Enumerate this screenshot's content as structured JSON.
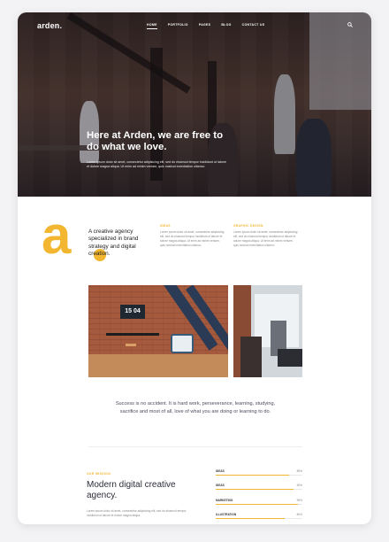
{
  "nav": {
    "logo": "arden.",
    "items": [
      "HOME",
      "PORTFOLIO",
      "PAGES",
      "BLOG",
      "CONTACT US"
    ],
    "active_index": 0
  },
  "hero": {
    "title": "Here at Arden, we are free to do what we love.",
    "text": "Lorem ipsum dolor sit amet, consectetur adipisicing elit, sed do eiusmod tempor incididunt ut labore et dolore magna aliqua. Ut enim ad minim veniam, quis nostrud exercitation ullamco"
  },
  "intro": {
    "letter": "a",
    "title": "A creative agency specialized in brand strategy and digital creation.",
    "col1_title": "IDEAS",
    "col1_text": "Lorem ipsum dolor sit amet, consectetur adipisicing elit, sed do eiusmod tempor incididunt ut labore et dolore magna aliqua. Ut enim ad minim veniam, quis nostrud exercitation ullamco",
    "col2_title": "GRAPHIC DESIGN",
    "col2_text": "Lorem ipsum dolor sit amet, consectetur adipisicing elit, sed do eiusmod tempor incididunt ut labore et dolore magna aliqua. Ut enim ad minim veniam, quis nostrud exercitation ullamco"
  },
  "photo": {
    "clock": "15 04"
  },
  "quote": "Success is no accident. It is hard work, perseverance, learning, studying, sacrifice and most of all, love of what you are doing or learning to do.",
  "about": {
    "label": "OUR MISSION",
    "title": "Modern digital creative agency.",
    "text": "Lorem ipsum dolor sit amet, consectetur adipisicing elit, sed do eiusmod tempor incididunt ut labore et dolore magna aliqua."
  },
  "skills": [
    {
      "name": "IDEAS",
      "pct": "85%",
      "value": 0.85
    },
    {
      "name": "IDEAS",
      "pct": "90%",
      "value": 0.9
    },
    {
      "name": "MARKETING",
      "pct": "95%",
      "value": 0.95
    },
    {
      "name": "ILLUSTRATION",
      "pct": "80%",
      "value": 0.8
    }
  ],
  "colors": {
    "accent": "#f2b631",
    "text_dark": "#2b2d3a",
    "text_muted": "#888888"
  },
  "icons": {
    "search": "search-icon"
  }
}
